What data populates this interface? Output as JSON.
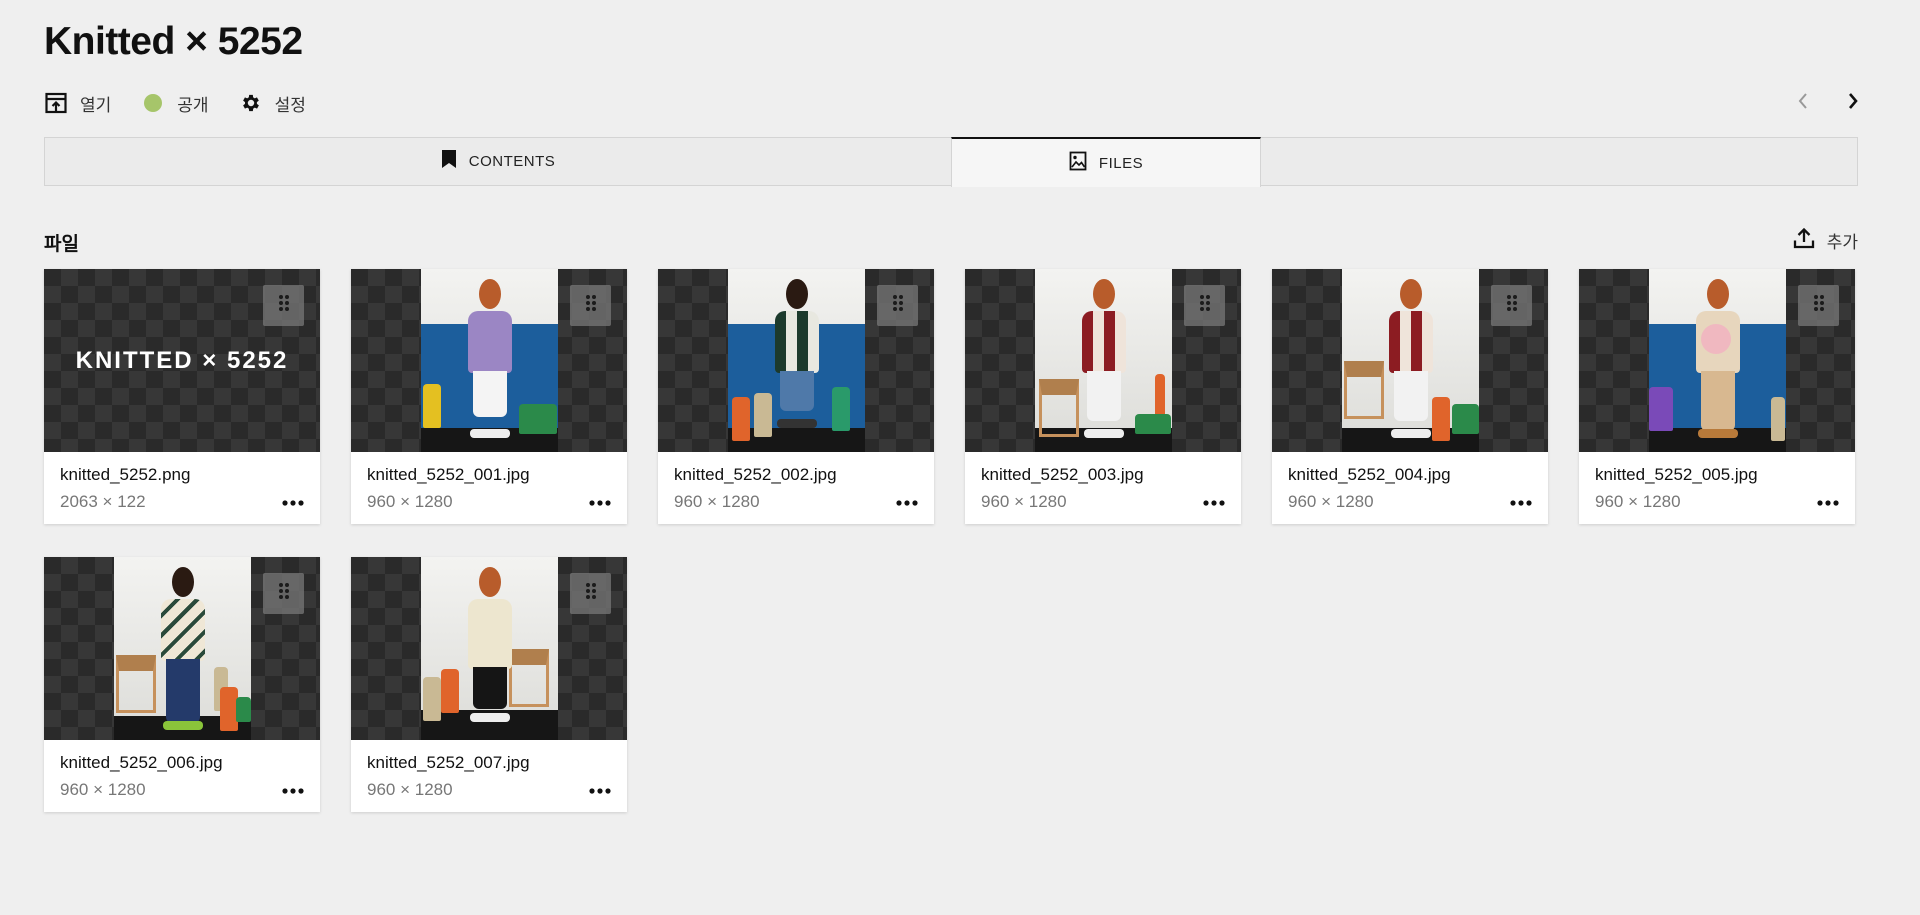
{
  "header": {
    "title": "Knitted × 5252"
  },
  "toolbar": {
    "open_label": "열기",
    "public_label": "공개",
    "settings_label": "설정",
    "status_color": "#a6c56a"
  },
  "tabs": [
    {
      "label": "CONTENTS",
      "icon": "bookmark-icon",
      "active": false
    },
    {
      "label": "FILES",
      "icon": "image-icon",
      "active": true
    }
  ],
  "files_section": {
    "label": "파일",
    "add_label": "추가",
    "files": [
      {
        "name": "knitted_5252.png",
        "dims": "2063 × 122",
        "logo_text": "KNITTED × 5252"
      },
      {
        "name": "knitted_5252_001.jpg",
        "dims": "960 × 1280"
      },
      {
        "name": "knitted_5252_002.jpg",
        "dims": "960 × 1280"
      },
      {
        "name": "knitted_5252_003.jpg",
        "dims": "960 × 1280"
      },
      {
        "name": "knitted_5252_004.jpg",
        "dims": "960 × 1280"
      },
      {
        "name": "knitted_5252_005.jpg",
        "dims": "960 × 1280"
      },
      {
        "name": "knitted_5252_006.jpg",
        "dims": "960 × 1280"
      },
      {
        "name": "knitted_5252_007.jpg",
        "dims": "960 × 1280"
      }
    ]
  }
}
